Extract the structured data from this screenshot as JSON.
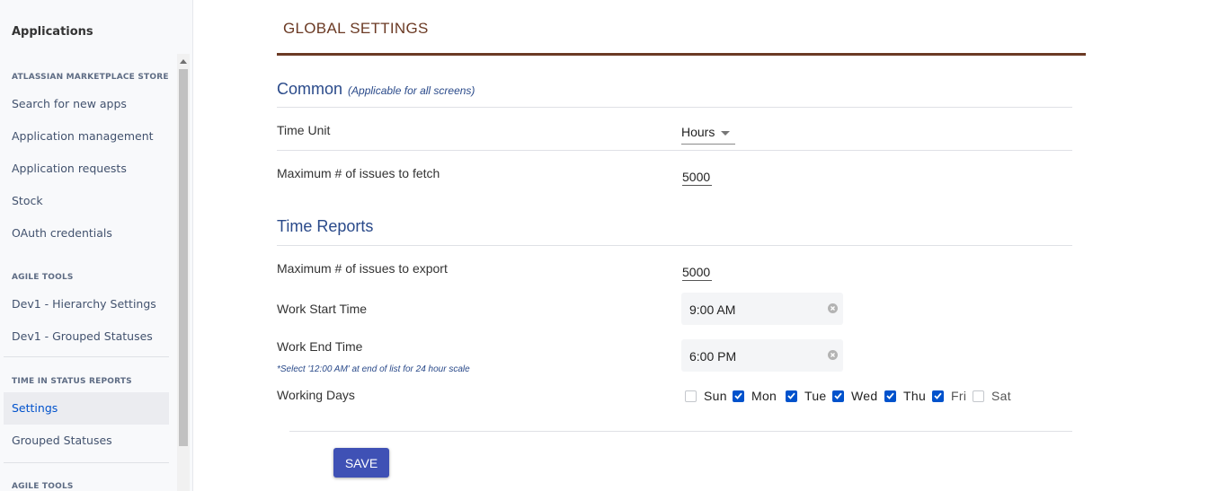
{
  "sidebar": {
    "app_title": "Applications",
    "sections": [
      {
        "title": "ATLASSIAN MARKETPLACE STORE",
        "items": [
          "Search for new apps",
          "Application management",
          "Application requests",
          "Stock",
          "OAuth credentials"
        ]
      },
      {
        "title": "AGILE TOOLS",
        "items": [
          "Dev1 - Hierarchy Settings",
          "Dev1 - Grouped Statuses"
        ]
      },
      {
        "title": "TIME IN STATUS REPORTS",
        "items": [
          "Settings",
          "Grouped Statuses"
        ]
      },
      {
        "title": "AGILE TOOLS",
        "items": []
      }
    ],
    "active_item": "Settings"
  },
  "main": {
    "title": "GLOBAL SETTINGS",
    "common": {
      "heading": "Common",
      "subheading": "(Applicable for all screens)",
      "time_unit_label": "Time Unit",
      "time_unit_value": "Hours",
      "max_fetch_label": "Maximum # of issues to fetch",
      "max_fetch_value": "5000"
    },
    "time_reports": {
      "heading": "Time Reports",
      "max_export_label": "Maximum # of issues to export",
      "max_export_value": "5000",
      "work_start_label": "Work Start Time",
      "work_start_value": "9:00 AM",
      "work_end_label": "Work End Time",
      "work_end_value": "6:00 PM",
      "work_end_hint": "*Select '12:00 AM' at end of list for 24 hour scale",
      "working_days_label": "Working Days",
      "days": [
        {
          "label": "Sun",
          "checked": false
        },
        {
          "label": "Mon",
          "checked": true
        },
        {
          "label": "Tue",
          "checked": true
        },
        {
          "label": "Wed",
          "checked": true
        },
        {
          "label": "Thu",
          "checked": true
        },
        {
          "label": "Fri",
          "checked": true
        },
        {
          "label": "Sat",
          "checked": false
        }
      ]
    },
    "save_label": "SAVE"
  },
  "colors": {
    "accent": "#0052cc",
    "title_brown": "#6b3a24",
    "section_blue": "#2a4a8a",
    "save_button": "#3f51b5"
  },
  "icons": {
    "dropdown": "caret-down-icon",
    "clear": "clear-circle-icon",
    "checkbox": "check-icon"
  }
}
